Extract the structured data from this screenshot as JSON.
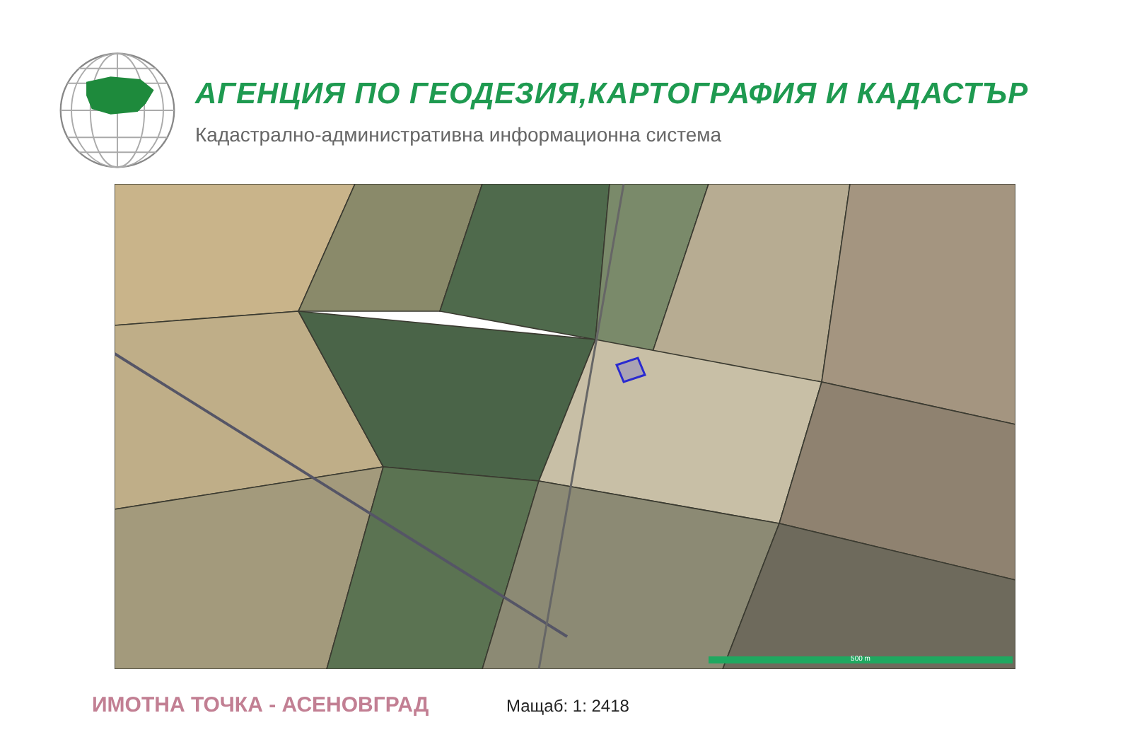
{
  "header": {
    "title": "АГЕНЦИЯ ПО ГЕОДЕЗИЯ,КАРТОГРАФИЯ И КАДАСТЪР",
    "subtitle": "Кадастрално-административна информационна система"
  },
  "map": {
    "scale_bar_label": "500 m"
  },
  "footer": {
    "property_title": "ИМОТНА ТОЧКА - АСЕНОВГРАД",
    "scale": "Мащаб: 1: 2418"
  }
}
